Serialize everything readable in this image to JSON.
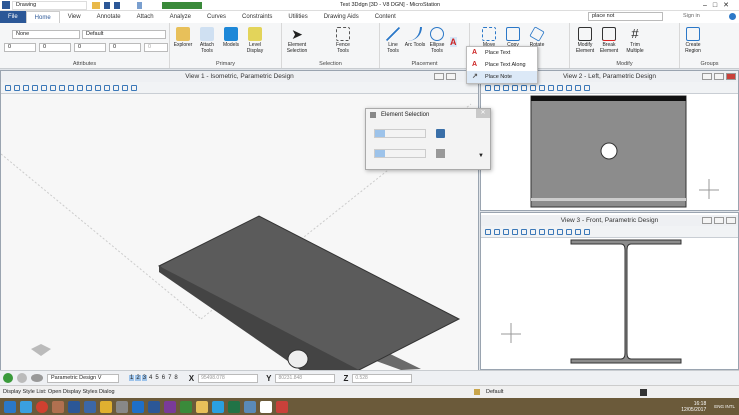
{
  "titlebar": {
    "workflow": "Drawing",
    "title": "Test 3Ddgn [3D - V8 DGN] - MicroStation"
  },
  "tabs": [
    "File",
    "Home",
    "View",
    "Annotate",
    "Attach",
    "Analyze",
    "Curves",
    "Constraints",
    "Utilities",
    "Drawing Aids",
    "Content"
  ],
  "search": {
    "value": "place not",
    "sign_in": "Sign in"
  },
  "ribbon": {
    "attributes": {
      "label": "Attributes",
      "level": "None",
      "style": "Default",
      "color": "0",
      "weight": "0",
      "line": "0",
      "transparency": "0",
      "priority": "0"
    },
    "primary": {
      "label": "Primary",
      "buttons": [
        "Explorer",
        "Attach Tools",
        "Models",
        "Level Display"
      ]
    },
    "selection": {
      "label": "Selection",
      "buttons": [
        "Element Selection",
        "Fence Tools"
      ]
    },
    "placement": {
      "label": "Placement",
      "buttons": [
        "Line Tools",
        "Arc Tools",
        "Ellipse Tools"
      ]
    },
    "manipulate": {
      "label": "Manipulate",
      "buttons": [
        "Move",
        "Copy",
        "Rotate"
      ]
    },
    "modify": {
      "label": "Modify",
      "buttons": [
        "Modify Element",
        "Break Element",
        "Trim Multiple"
      ]
    },
    "groups": {
      "label": "Groups",
      "buttons": [
        "Create Region"
      ]
    }
  },
  "text_menu": [
    "Place Text",
    "Place Text Along",
    "Place Note"
  ],
  "views": {
    "v1": "View 1 - Isometric, Parametric Design",
    "v2": "View 2 - Left, Parametric Design",
    "v3": "View 3 - Front, Parametric Design"
  },
  "element_selection": {
    "title": "Element Selection"
  },
  "bottombar": {
    "model": "Parametric Design V",
    "views": [
      "1",
      "2",
      "3",
      "4",
      "5",
      "6",
      "7",
      "8"
    ],
    "x_label": "X",
    "x": "95498.078",
    "y_label": "Y",
    "y": "80231.848",
    "z_label": "Z",
    "z": "0.528"
  },
  "status": {
    "message": "Display Style List: Open Display Styles Dialog",
    "level": "Default"
  },
  "clock": {
    "time": "16:18",
    "date": "12/05/2017",
    "lang": "ENG INTL"
  },
  "colors": {
    "accent": "#2b5797",
    "taskbar": "#6b5a3a",
    "steel": "#8a8a8a"
  }
}
